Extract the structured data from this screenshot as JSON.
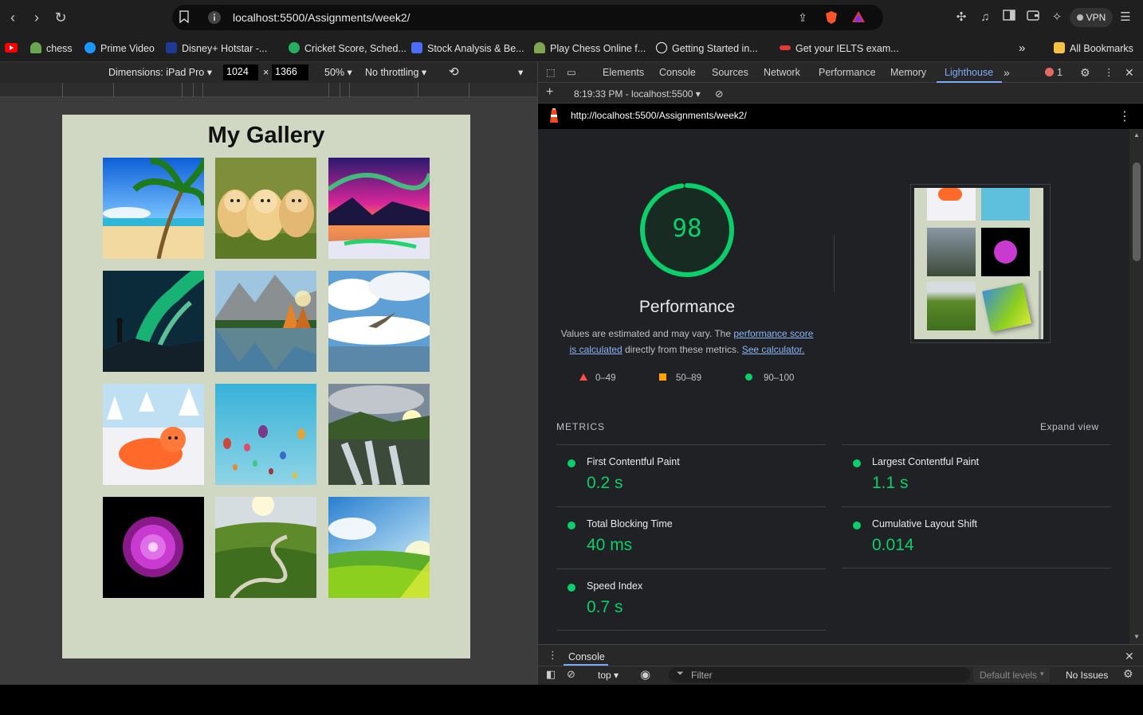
{
  "browser": {
    "url": "localhost:5500/Assignments/week2/",
    "vpn_label": "VPN",
    "bookmarks": [
      {
        "label": "chess",
        "color": "#6aa84f"
      },
      {
        "label": "Prime Video",
        "color": "#1a98ff"
      },
      {
        "label": "Disney+ Hotstar -...",
        "color": "#1f3a93"
      },
      {
        "label": "Cricket Score, Sched...",
        "color": "#27ae60"
      },
      {
        "label": "Stock Analysis & Be...",
        "color": "#4a6cf7"
      },
      {
        "label": "Play Chess Online f...",
        "color": "#7fa650"
      },
      {
        "label": "Getting Started in...",
        "color": "#ffffff"
      },
      {
        "label": "Get your IELTS exam...",
        "color": "#e53935"
      }
    ],
    "all_bookmarks": "All Bookmarks"
  },
  "device_toolbar": {
    "dimensions_label": "Dimensions: iPad Pro",
    "width": "1024",
    "height": "1366",
    "times": "×",
    "zoom": "50%",
    "throttling": "No throttling"
  },
  "gallery": {
    "title": "My Gallery",
    "images": [
      "beach-palm",
      "puppies",
      "aurora-lake",
      "aurora-hiker",
      "mountain-lake",
      "bird-clouds",
      "orange-cat-toy",
      "hot-air-balloons",
      "waterfall-sunset",
      "purple-flower",
      "green-valley-road",
      "green-field-sky"
    ]
  },
  "devtools": {
    "tabs": [
      "Elements",
      "Console",
      "Sources",
      "Network",
      "Performance",
      "Memory",
      "Lighthouse"
    ],
    "active_tab": "Lighthouse",
    "error_count": "1",
    "report_time": "8:19:33 PM - localhost:5500",
    "report_url": "http://localhost:5500/Assignments/week2/"
  },
  "lighthouse": {
    "score": "98",
    "category": "Performance",
    "desc_1": "Values are estimated and may vary. The ",
    "desc_link1": "performance score is calculated",
    "desc_2": " directly from these metrics. ",
    "desc_link2": "See calculator.",
    "legend": [
      "0–49",
      "50–89",
      "90–100"
    ],
    "metrics_title": "METRICS",
    "expand_view": "Expand view",
    "metrics": [
      {
        "label": "First Contentful Paint",
        "value": "0.2 s"
      },
      {
        "label": "Largest Contentful Paint",
        "value": "1.1 s"
      },
      {
        "label": "Total Blocking Time",
        "value": "40 ms"
      },
      {
        "label": "Cumulative Layout Shift",
        "value": "0.014"
      },
      {
        "label": "Speed Index",
        "value": "0.7 s"
      }
    ]
  },
  "console": {
    "tab": "Console",
    "context": "top",
    "filter_placeholder": "Filter",
    "levels": "Default levels",
    "issues": "No Issues"
  }
}
